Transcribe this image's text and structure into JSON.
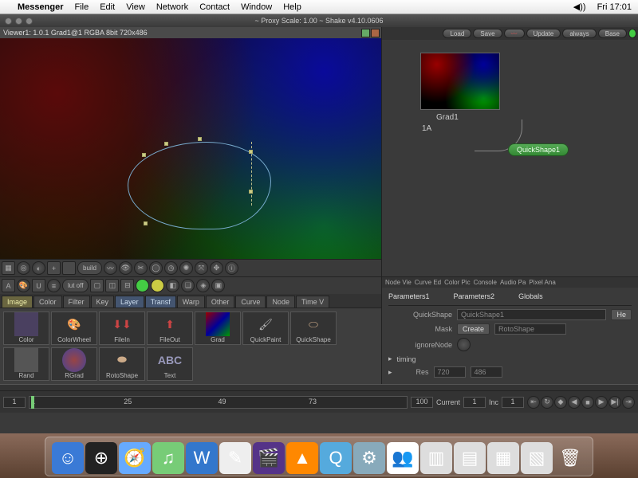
{
  "menubar": {
    "app": "Messenger",
    "items": [
      "File",
      "Edit",
      "View",
      "Network",
      "Contact",
      "Window",
      "Help"
    ],
    "clock": "Fri 17:01"
  },
  "window": {
    "title": "~ Proxy Scale: 1.00 ~ Shake v4.10.0606"
  },
  "viewer": {
    "header": "Viewer1: 1.0.1 Grad1@1 RGBA 8bit 720x486"
  },
  "right_buttons": {
    "load": "Load",
    "save": "Save",
    "update": "Update",
    "always": "always",
    "base": "Base"
  },
  "nodes": {
    "grad": "Grad1",
    "port": "1A",
    "quickshape": "QuickShape1"
  },
  "panel_tabs": [
    "Node Vie",
    "Curve Ed",
    "Color Pic",
    "Console",
    "Audio Pa",
    "Pixel Ana"
  ],
  "param_tabs": [
    "Parameters1",
    "Parameters2",
    "Globals"
  ],
  "params": {
    "quickshape_label": "QuickShape",
    "quickshape_value": "QuickShape1",
    "mask_label": "Mask",
    "create_btn": "Create",
    "rotoshape": "RotoShape",
    "ignore_label": "ignoreNode",
    "timing_label": "timing",
    "res_label": "Res",
    "res_w": "720",
    "res_h": "486",
    "he_btn": "He"
  },
  "category_tabs": [
    "Image",
    "Color",
    "Filter",
    "Key",
    "Layer",
    "Transf",
    "Warp",
    "Other",
    "Curve",
    "Node",
    "Time V"
  ],
  "palette": [
    {
      "label": "Color"
    },
    {
      "label": "ColorWheel"
    },
    {
      "label": "FileIn"
    },
    {
      "label": "FileOut"
    },
    {
      "label": "Grad"
    },
    {
      "label": "QuickPaint"
    },
    {
      "label": "QuickShape"
    },
    {
      "label": "Rand"
    },
    {
      "label": "RGrad"
    },
    {
      "label": "RotoShape"
    },
    {
      "label": "Text"
    }
  ],
  "toolbar2": {
    "lutoff": "lut off",
    "build": "build"
  },
  "timeline": {
    "start": "1",
    "t25": "25",
    "t49": "49",
    "t73": "73",
    "end": "100",
    "current_label": "Current",
    "current": "1",
    "inc_label": "Inc",
    "inc": "1"
  }
}
